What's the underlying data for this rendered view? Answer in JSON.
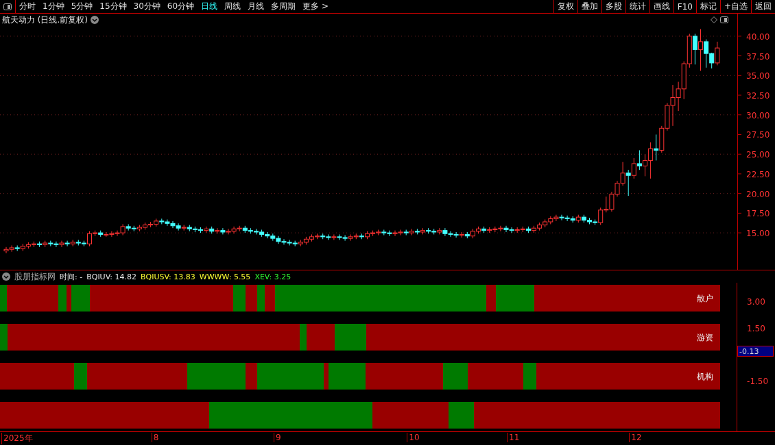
{
  "toolbar": {
    "periods": [
      {
        "label": "分时",
        "selected": false
      },
      {
        "label": "1分钟",
        "selected": false
      },
      {
        "label": "5分钟",
        "selected": false
      },
      {
        "label": "15分钟",
        "selected": false
      },
      {
        "label": "30分钟",
        "selected": false
      },
      {
        "label": "60分钟",
        "selected": false
      },
      {
        "label": "日线",
        "selected": true
      },
      {
        "label": "周线",
        "selected": false
      },
      {
        "label": "月线",
        "selected": false
      },
      {
        "label": "多周期",
        "selected": false
      },
      {
        "label": "更多 >",
        "selected": false
      }
    ],
    "buttons": [
      "复权",
      "叠加",
      "多股",
      "统计",
      "画线",
      "F10",
      "标记",
      "+自选",
      "返回"
    ]
  },
  "main_chart": {
    "title": "航天动力 (日线.前复权)",
    "chart_data": {
      "type": "candlestick",
      "ylim": [
        10.31,
        42.86
      ],
      "yticks": [
        {
          "value": 15,
          "label": "15.00"
        },
        {
          "value": 17.5,
          "label": "17.50"
        },
        {
          "value": 20,
          "label": "20.00"
        },
        {
          "value": 22.5,
          "label": "22.50"
        },
        {
          "value": 25,
          "label": "25.00"
        },
        {
          "value": 27.5,
          "label": "27.50"
        },
        {
          "value": 30,
          "label": "30.00"
        },
        {
          "value": 32.5,
          "label": "32.50"
        },
        {
          "value": 35,
          "label": "35.00"
        },
        {
          "value": 37.5,
          "label": "37.50"
        },
        {
          "value": 40,
          "label": "40.00"
        }
      ],
      "grid": true,
      "ohlc": [
        [
          12.7,
          13.2,
          12.4,
          12.9
        ],
        [
          12.9,
          13.4,
          12.6,
          13.1
        ],
        [
          13.1,
          13.4,
          12.7,
          13.0
        ],
        [
          13.0,
          13.6,
          12.7,
          13.3
        ],
        [
          13.3,
          13.8,
          13.0,
          13.5
        ],
        [
          13.5,
          13.9,
          13.2,
          13.6
        ],
        [
          13.6,
          13.9,
          13.2,
          13.5
        ],
        [
          13.5,
          14.0,
          13.2,
          13.7
        ],
        [
          13.7,
          14.0,
          13.3,
          13.6
        ],
        [
          13.6,
          13.9,
          13.2,
          13.5
        ],
        [
          13.5,
          14.0,
          13.2,
          13.7
        ],
        [
          13.7,
          14.0,
          13.3,
          13.6
        ],
        [
          13.6,
          14.1,
          13.3,
          13.8
        ],
        [
          13.8,
          14.1,
          13.4,
          13.7
        ],
        [
          13.7,
          14.0,
          13.3,
          13.6
        ],
        [
          13.6,
          15.2,
          13.3,
          14.9
        ],
        [
          14.9,
          15.3,
          14.6,
          15.0
        ],
        [
          15.0,
          15.3,
          14.5,
          14.8
        ],
        [
          14.8,
          15.1,
          14.5,
          14.8
        ],
        [
          14.8,
          15.2,
          14.5,
          14.9
        ],
        [
          14.9,
          15.3,
          14.6,
          15.0
        ],
        [
          15.0,
          16.1,
          14.7,
          15.8
        ],
        [
          15.8,
          16.1,
          15.3,
          15.6
        ],
        [
          15.6,
          15.9,
          15.2,
          15.5
        ],
        [
          15.5,
          16.0,
          15.2,
          15.7
        ],
        [
          15.7,
          16.3,
          15.4,
          16.0
        ],
        [
          16.0,
          16.4,
          15.7,
          16.1
        ],
        [
          16.1,
          16.8,
          15.8,
          16.5
        ],
        [
          16.5,
          16.8,
          16.1,
          16.4
        ],
        [
          16.4,
          16.7,
          15.9,
          16.2
        ],
        [
          16.2,
          16.5,
          15.6,
          15.9
        ],
        [
          15.9,
          16.2,
          15.3,
          15.6
        ],
        [
          15.6,
          16.0,
          15.3,
          15.7
        ],
        [
          15.7,
          16.0,
          15.2,
          15.5
        ],
        [
          15.5,
          15.8,
          15.1,
          15.4
        ],
        [
          15.4,
          15.7,
          15.0,
          15.3
        ],
        [
          15.3,
          15.8,
          15.0,
          15.5
        ],
        [
          15.5,
          15.8,
          14.9,
          15.2
        ],
        [
          15.2,
          15.6,
          14.9,
          15.3
        ],
        [
          15.3,
          15.6,
          14.8,
          15.1
        ],
        [
          15.1,
          15.5,
          14.8,
          15.2
        ],
        [
          15.2,
          15.8,
          14.9,
          15.5
        ],
        [
          15.5,
          15.9,
          15.2,
          15.6
        ],
        [
          15.6,
          15.9,
          15.0,
          15.3
        ],
        [
          15.3,
          15.6,
          14.9,
          15.2
        ],
        [
          15.2,
          15.5,
          14.8,
          15.1
        ],
        [
          15.1,
          15.4,
          14.5,
          14.8
        ],
        [
          14.8,
          15.1,
          14.3,
          14.6
        ],
        [
          14.6,
          14.9,
          14.0,
          14.3
        ],
        [
          14.3,
          14.6,
          13.6,
          13.9
        ],
        [
          13.9,
          14.2,
          13.5,
          13.8
        ],
        [
          13.8,
          14.1,
          13.4,
          13.7
        ],
        [
          13.7,
          14.0,
          13.3,
          13.6
        ],
        [
          13.6,
          14.1,
          13.3,
          13.8
        ],
        [
          13.8,
          14.5,
          13.5,
          14.2
        ],
        [
          14.2,
          14.8,
          13.9,
          14.5
        ],
        [
          14.5,
          14.9,
          14.2,
          14.6
        ],
        [
          14.6,
          14.9,
          14.2,
          14.5
        ],
        [
          14.5,
          14.8,
          14.1,
          14.4
        ],
        [
          14.4,
          14.8,
          14.1,
          14.5
        ],
        [
          14.5,
          14.8,
          14.1,
          14.4
        ],
        [
          14.4,
          14.7,
          14.0,
          14.3
        ],
        [
          14.3,
          14.8,
          14.0,
          14.5
        ],
        [
          14.5,
          14.9,
          14.2,
          14.6
        ],
        [
          14.6,
          14.9,
          14.2,
          14.5
        ],
        [
          14.5,
          15.2,
          14.2,
          14.9
        ],
        [
          14.9,
          15.3,
          14.6,
          15.0
        ],
        [
          15.0,
          15.4,
          14.7,
          15.1
        ],
        [
          15.1,
          15.4,
          14.7,
          15.0
        ],
        [
          15.0,
          15.3,
          14.6,
          14.9
        ],
        [
          14.9,
          15.3,
          14.6,
          15.0
        ],
        [
          15.0,
          15.4,
          14.7,
          15.1
        ],
        [
          15.1,
          15.4,
          14.7,
          15.0
        ],
        [
          15.0,
          15.5,
          14.7,
          15.2
        ],
        [
          15.2,
          15.5,
          14.8,
          15.1
        ],
        [
          15.1,
          15.6,
          14.8,
          15.3
        ],
        [
          15.3,
          15.6,
          14.9,
          15.2
        ],
        [
          15.2,
          15.5,
          14.8,
          15.1
        ],
        [
          15.1,
          15.6,
          14.8,
          15.3
        ],
        [
          15.3,
          15.6,
          14.6,
          14.9
        ],
        [
          14.9,
          15.2,
          14.5,
          14.8
        ],
        [
          14.8,
          15.1,
          14.4,
          14.7
        ],
        [
          14.7,
          15.1,
          14.4,
          14.8
        ],
        [
          14.8,
          15.1,
          14.3,
          14.6
        ],
        [
          14.6,
          15.5,
          14.3,
          15.2
        ],
        [
          15.2,
          15.8,
          14.9,
          15.5
        ],
        [
          15.5,
          15.8,
          15.0,
          15.3
        ],
        [
          15.3,
          15.7,
          15.0,
          15.4
        ],
        [
          15.4,
          15.8,
          15.1,
          15.5
        ],
        [
          15.5,
          15.9,
          15.2,
          15.6
        ],
        [
          15.6,
          15.9,
          15.1,
          15.4
        ],
        [
          15.4,
          15.7,
          15.0,
          15.3
        ],
        [
          15.3,
          15.7,
          15.0,
          15.4
        ],
        [
          15.4,
          15.8,
          15.1,
          15.5
        ],
        [
          15.5,
          15.8,
          15.0,
          15.3
        ],
        [
          15.3,
          15.9,
          15.0,
          15.6
        ],
        [
          15.6,
          16.3,
          15.3,
          16.0
        ],
        [
          16.0,
          16.7,
          15.7,
          16.4
        ],
        [
          16.4,
          17.1,
          16.1,
          16.8
        ],
        [
          16.8,
          17.3,
          16.5,
          17.0
        ],
        [
          17.0,
          17.3,
          16.6,
          16.9
        ],
        [
          16.9,
          17.2,
          16.5,
          16.8
        ],
        [
          16.8,
          17.1,
          16.3,
          16.6
        ],
        [
          16.6,
          17.3,
          16.3,
          17.0
        ],
        [
          17.0,
          17.3,
          16.3,
          16.6
        ],
        [
          16.6,
          16.9,
          16.1,
          16.4
        ],
        [
          16.4,
          16.7,
          16.0,
          16.3
        ],
        [
          16.3,
          18.2,
          16.0,
          17.9
        ],
        [
          17.9,
          19.6,
          17.6,
          18.0
        ],
        [
          18.0,
          20.2,
          17.7,
          19.9
        ],
        [
          19.9,
          21.6,
          19.6,
          21.3
        ],
        [
          21.3,
          24.0,
          21.0,
          22.6
        ],
        [
          22.6,
          23.0,
          19.7,
          22.3
        ],
        [
          22.3,
          24.5,
          21.9,
          23.8
        ],
        [
          23.8,
          25.5,
          23.0,
          23.5
        ],
        [
          23.5,
          25.0,
          22.2,
          24.2
        ],
        [
          24.2,
          26.5,
          21.9,
          25.7
        ],
        [
          25.7,
          27.5,
          24.2,
          25.5
        ],
        [
          25.5,
          28.6,
          25.2,
          28.3
        ],
        [
          28.3,
          31.5,
          28.0,
          31.2
        ],
        [
          31.2,
          33.8,
          28.6,
          32.2
        ],
        [
          32.2,
          34.2,
          30.5,
          33.3
        ],
        [
          33.3,
          36.8,
          32.0,
          36.5
        ],
        [
          36.5,
          40.3,
          36.0,
          40.0
        ],
        [
          40.0,
          40.3,
          36.4,
          38.3
        ],
        [
          38.3,
          40.9,
          35.6,
          39.3
        ],
        [
          39.3,
          39.6,
          36.0,
          37.8
        ],
        [
          37.8,
          37.9,
          35.9,
          36.6
        ],
        [
          36.6,
          39.3,
          36.3,
          38.5
        ]
      ]
    }
  },
  "indicator": {
    "name": "股朋指标网",
    "time": "时间: -",
    "values": [
      {
        "text": "BQIUV: 14.82",
        "color": "#e8e8e8"
      },
      {
        "text": "BQIUSV: 13.83",
        "color": "#ffff33"
      },
      {
        "text": "WWWW: 5.55",
        "color": "#ffff33"
      },
      {
        "text": "XEV: 3.25",
        "color": "#33ff33"
      }
    ],
    "bands": [
      {
        "label": "散户",
        "segments": [
          {
            "color": "#007a00"
          },
          {
            "color": "#990000"
          },
          {
            "color": "#007a00"
          },
          {
            "color": "#990000"
          },
          {
            "color": "#007a00"
          },
          {
            "color": "#990000"
          },
          {
            "color": "#007a00"
          },
          {
            "color": "#990000"
          },
          {
            "color": "#007a00"
          },
          {
            "color": "#990000"
          },
          {
            "color": "#007a00"
          },
          {
            "color": "#990000"
          },
          {
            "color": "#007a00"
          },
          {
            "color": "#990000"
          }
        ]
      },
      {
        "label": "游资",
        "segments": [
          {
            "color": "#007a00"
          },
          {
            "color": "#990000"
          },
          {
            "color": "#007a00"
          },
          {
            "color": "#990000"
          },
          {
            "color": "#007a00"
          },
          {
            "color": "#990000"
          }
        ]
      },
      {
        "label": "机构",
        "segments": [
          {
            "color": "#990000"
          },
          {
            "color": "#007a00"
          },
          {
            "color": "#990000"
          },
          {
            "color": "#007a00"
          },
          {
            "color": "#990000"
          },
          {
            "color": "#007a00"
          },
          {
            "color": "#990000"
          },
          {
            "color": "#007a00"
          },
          {
            "color": "#990000"
          },
          {
            "color": "#007a00"
          },
          {
            "color": "#990000"
          },
          {
            "color": "#007a00"
          },
          {
            "color": "#990000"
          }
        ]
      },
      {
        "segments": [
          {
            "color": "#990000"
          },
          {
            "color": "#007a00"
          },
          {
            "color": "#990000"
          },
          {
            "color": "#007a00"
          },
          {
            "color": "#990000"
          }
        ]
      }
    ],
    "axis_ticks": [
      "3.00",
      "1.50",
      "-1.50"
    ],
    "current_value": "-0.13"
  },
  "time_axis": [
    "2025年",
    "8",
    "9",
    "10",
    "11",
    "12"
  ]
}
